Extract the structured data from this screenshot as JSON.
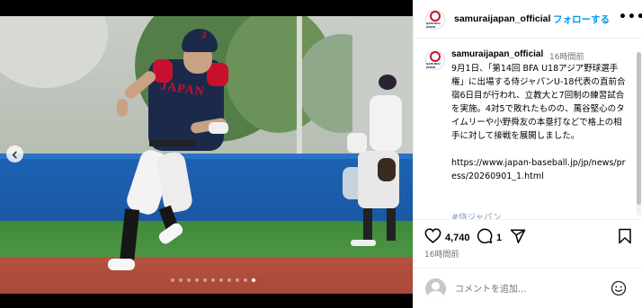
{
  "account": {
    "username": "samuraijapan_official",
    "follow_label": "フォローする",
    "avatar_text": "SAMURAI JAPAN"
  },
  "header": {
    "more_label": "•••"
  },
  "caption": {
    "username": "samuraijapan_official",
    "time": "16時間前",
    "text": "9月1日、「第14回 BFA U18アジア野球選手権」に出場する侍ジャパンU-18代表の直前合宿6日目が行われ、立教大と7回制の練習試合を実施。4対5で敗れたものの、萬谷堅心のタイムリーや小野舜友の本塁打などで格上の相手に対して接戦を展開しました。\n\nhttps://www.japan-baseball.jp/jp/news/press/20260901_1.html",
    "hashtag": "#侍ジャパン"
  },
  "photo": {
    "jersey_text": "JAPAN",
    "helmet_letter": "J",
    "carousel_count": 11,
    "carousel_active": 10
  },
  "actions": {
    "likes": "4,740",
    "comments": "1",
    "time_ago": "16時間前"
  },
  "comment_box": {
    "placeholder": "コメントを追加..."
  },
  "colors": {
    "follow": "#0095f6",
    "secondary_text": "#737373",
    "field_wall": "#1c63b4",
    "jersey": "#1b2a4a",
    "jersey_sleeve": "#c8102e"
  },
  "icons": [
    "chevron-left-icon",
    "heart-icon",
    "comment-icon",
    "share-icon",
    "bookmark-icon",
    "more-icon",
    "emoji-icon",
    "user-avatar-icon"
  ]
}
